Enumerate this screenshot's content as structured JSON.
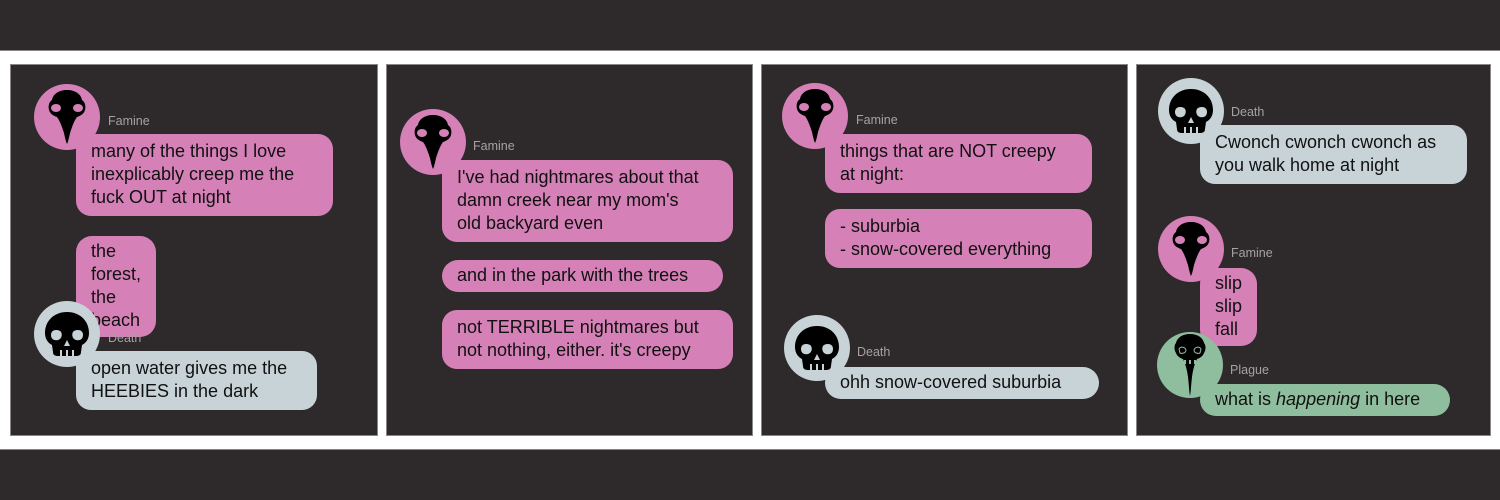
{
  "colors": {
    "background": "#2e292b",
    "strip": "#ffffff",
    "famine": "#d580b6",
    "death": "#c7d3d6",
    "plague": "#8fbe9e",
    "name_label": "#a6a1a3",
    "text": "#111111"
  },
  "characters": {
    "famine": {
      "name": "Famine",
      "icon": "bird-skull-icon"
    },
    "death": {
      "name": "Death",
      "icon": "human-skull-icon"
    },
    "plague": {
      "name": "Plague",
      "icon": "plague-beak-skull-icon"
    }
  },
  "panels": [
    {
      "messages": [
        {
          "speaker": "Famine",
          "bubbles": [
            "many of the things I love\ninexplicably creep me the\nfuck OUT at night",
            "the forest, the beach"
          ]
        },
        {
          "speaker": "Death",
          "bubbles": [
            "open water gives me the\nHEEBIES in the dark"
          ]
        }
      ]
    },
    {
      "messages": [
        {
          "speaker": "Famine",
          "bubbles": [
            "I've had nightmares about that\ndamn creek near my mom's\nold backyard even",
            "and in the park with the trees",
            "not TERRIBLE nightmares but\nnot nothing, either. it's creepy"
          ]
        }
      ]
    },
    {
      "messages": [
        {
          "speaker": "Famine",
          "bubbles": [
            "things that are NOT creepy\nat night:",
            "- suburbia\n- snow-covered everything"
          ]
        },
        {
          "speaker": "Death",
          "bubbles": [
            "ohh snow-covered suburbia"
          ]
        }
      ]
    },
    {
      "messages": [
        {
          "speaker": "Death",
          "bubbles": [
            "Cwonch cwonch cwonch as\nyou walk home at night"
          ]
        },
        {
          "speaker": "Famine",
          "bubbles": [
            "slip slip fall"
          ]
        },
        {
          "speaker": "Plague",
          "bubbles": [
            "what is happening in here"
          ],
          "emphasis_word": "happening",
          "before": "what is ",
          "after": " in here"
        }
      ]
    }
  ]
}
